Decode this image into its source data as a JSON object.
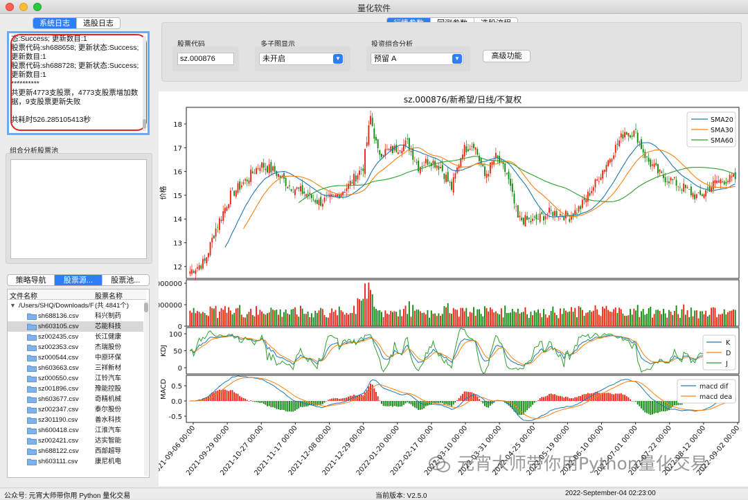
{
  "window": {
    "title": "量化软件"
  },
  "left": {
    "tabs": [
      {
        "label": "系统日志",
        "active": true
      },
      {
        "label": "选股日志",
        "active": false
      }
    ],
    "log_text": "态:Success; 更新数目:1\n股票代码:sh688658; 更新状态:Success; 更新数目:1\n股票代码:sh688728; 更新状态:Success; 更新数目:1\n**********\n共更新4773支股票，4773支股票增加数据，9支股票更新失败\n\n共耗时526.285105413秒",
    "pool_label": "组合分析股票池",
    "nav_tabs": [
      {
        "label": "策略导航",
        "active": false
      },
      {
        "label": "股票源...",
        "active": true
      },
      {
        "label": "股票池...",
        "active": false
      }
    ],
    "file_headers": {
      "name": "文件名称",
      "stock": "股票名称"
    },
    "root": {
      "path": "/Users/SHQ/Downloads/F",
      "count": "(共 4841个)"
    },
    "files": [
      {
        "file": "sh688136.csv",
        "name": "科兴制药",
        "selected": false
      },
      {
        "file": "sh603105.csv",
        "name": "芯能科技",
        "selected": true
      },
      {
        "file": "sz002435.csv",
        "name": "长江健康",
        "selected": false
      },
      {
        "file": "sz002353.csv",
        "name": "杰瑞股份",
        "selected": false
      },
      {
        "file": "sz000544.csv",
        "name": "中原环保",
        "selected": false
      },
      {
        "file": "sh603663.csv",
        "name": "三祥新材",
        "selected": false
      },
      {
        "file": "sz000550.csv",
        "name": "江铃汽车",
        "selected": false
      },
      {
        "file": "sz001896.csv",
        "name": "豫能控股",
        "selected": false
      },
      {
        "file": "sh603677.csv",
        "name": "奇精机械",
        "selected": false
      },
      {
        "file": "sz002347.csv",
        "name": "泰尔股份",
        "selected": false
      },
      {
        "file": "sz301190.csv",
        "name": "善水科技",
        "selected": false
      },
      {
        "file": "sh600418.csv",
        "name": "江淮汽车",
        "selected": false
      },
      {
        "file": "sz002421.csv",
        "name": "达实智能",
        "selected": false
      },
      {
        "file": "sh688122.csv",
        "name": "西部超导",
        "selected": false
      },
      {
        "file": "sh603111.csv",
        "name": "康尼机电",
        "selected": false
      }
    ]
  },
  "right": {
    "tabs": [
      {
        "label": "行情参数",
        "active": true
      },
      {
        "label": "回测参数",
        "active": false
      },
      {
        "label": "选股流程",
        "active": false
      }
    ],
    "stock_code_label": "股票代码",
    "stock_code_value": "sz.000876",
    "multi_label": "多子图显示",
    "multi_value": "未开启",
    "portfolio_label": "投资组合分析",
    "portfolio_value": "预留 A",
    "advanced_label": "高级功能"
  },
  "status": {
    "left": "公众号:  元宵大师带你用 Python 量化交易",
    "version": "当前版本:  V2.5.0",
    "time": "2022-September-04 02:23:00"
  },
  "watermark": "元宵大师带你用Python量化交易",
  "chart_data": {
    "type": "candlestick",
    "title": "sz.000876/新希望/日线/不复权",
    "price_ylabel": "价格",
    "price_yticks": [
      12,
      13,
      14,
      15,
      16,
      17,
      18
    ],
    "price_ylim": [
      11.5,
      18.7
    ],
    "ma_legend": [
      "SMA20",
      "SMA30",
      "SMA60"
    ],
    "ma_colors": [
      "#1f77b4",
      "#ff7f0e",
      "#2ca02c"
    ],
    "volume_ytick_labels": [
      "0",
      "000000",
      "000000"
    ],
    "kdj_ylabel": "KDJ",
    "kdj_yticks": [
      0,
      50,
      100
    ],
    "kdj_legend": [
      "K",
      "D",
      "J"
    ],
    "macd_ylabel": "MACD",
    "macd_yticks": [
      -0.5,
      0.0,
      0.5
    ],
    "macd_legend": [
      "macd dif",
      "macd dea"
    ],
    "up_color": "#ee2211",
    "down_color": "#118811",
    "x_tick_labels": [
      "2021-09-06 00:00",
      "2021-09-29 00:00",
      "2021-10-27 00:00",
      "2021-11-17 00:00",
      "2021-12-08 00:00",
      "2021-12-29 00:00",
      "2022-01-20 00:00",
      "2022-02-17 00:00",
      "2022-03-10 00:00",
      "2022-03-31 00:00",
      "2022-04-25 00:00",
      "2022-05-19 00:00",
      "2022-06-10 00:00",
      "2022-07-01 00:00",
      "2022-07-22 00:00",
      "2022-08-12 00:00",
      "2022-09-02 00:00"
    ],
    "close_keypoints": [
      [
        0,
        11.8
      ],
      [
        8,
        12.2
      ],
      [
        14,
        13.6
      ],
      [
        22,
        15.0
      ],
      [
        30,
        15.6
      ],
      [
        38,
        16.3
      ],
      [
        46,
        16.0
      ],
      [
        54,
        15.4
      ],
      [
        62,
        15.1
      ],
      [
        70,
        14.7
      ],
      [
        78,
        14.9
      ],
      [
        86,
        15.4
      ],
      [
        94,
        16.2
      ],
      [
        98,
        18.3
      ],
      [
        102,
        16.8
      ],
      [
        110,
        16.9
      ],
      [
        118,
        17.2
      ],
      [
        124,
        16.2
      ],
      [
        130,
        16.5
      ],
      [
        136,
        16.2
      ],
      [
        142,
        15.3
      ],
      [
        148,
        16.9
      ],
      [
        154,
        17.2
      ],
      [
        160,
        15.8
      ],
      [
        166,
        16.6
      ],
      [
        172,
        15.9
      ],
      [
        178,
        14.0
      ],
      [
        186,
        13.9
      ],
      [
        196,
        14.3
      ],
      [
        206,
        14.1
      ],
      [
        212,
        14.5
      ],
      [
        220,
        15.5
      ],
      [
        228,
        16.6
      ],
      [
        236,
        17.7
      ],
      [
        242,
        17.6
      ],
      [
        248,
        16.5
      ],
      [
        256,
        15.8
      ],
      [
        262,
        15.6
      ],
      [
        268,
        15.3
      ],
      [
        276,
        14.9
      ],
      [
        286,
        15.6
      ],
      [
        296,
        15.7
      ]
    ],
    "n_bars": 297
  }
}
